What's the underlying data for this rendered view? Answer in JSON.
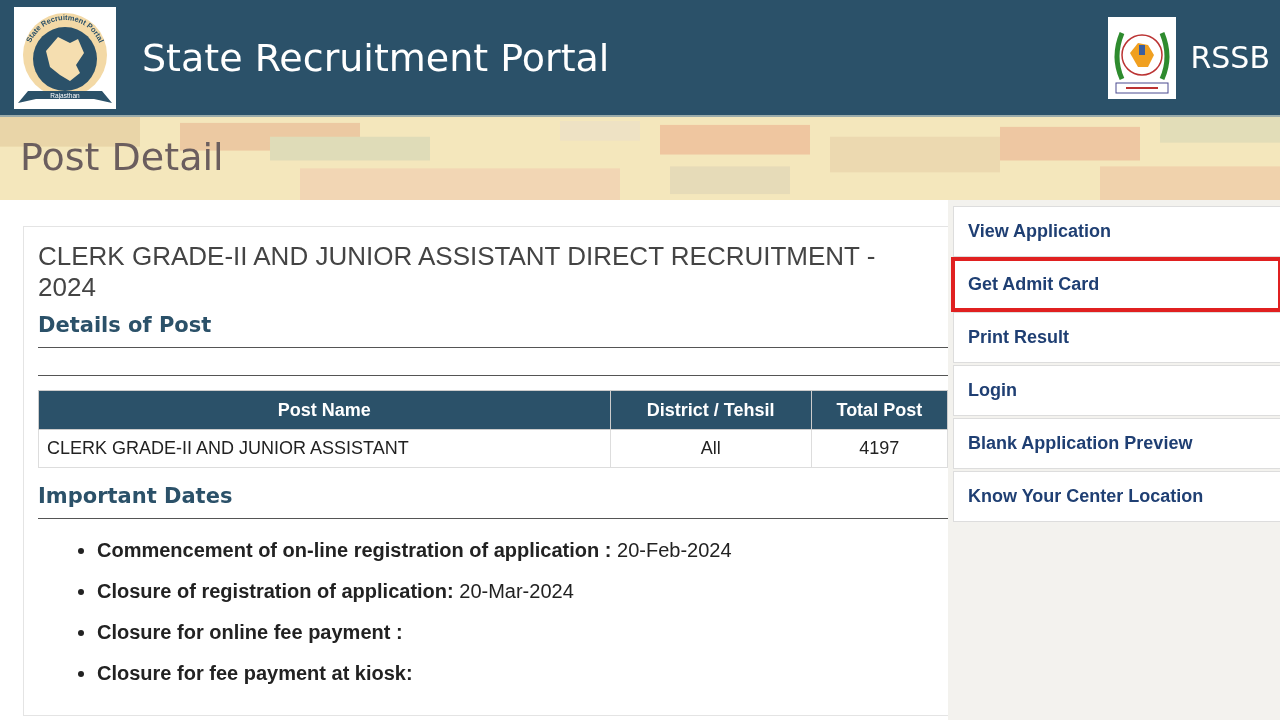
{
  "header": {
    "logo": {
      "arc_text": "State Recruitment Portal",
      "ribbon_text": "Rajasthan"
    },
    "title": "State Recruitment Portal",
    "org": "RSSB"
  },
  "banner": {
    "kind": "picture",
    "title": "Post Detail"
  },
  "post": {
    "title": "CLERK GRADE-II AND JUNIOR ASSISTANT DIRECT RECRUITMENT - 2024",
    "details_heading": "Details of Post",
    "table": {
      "columns": [
        "Post Name",
        "District / Tehsil",
        "Total Post"
      ],
      "rows": [
        [
          "CLERK GRADE-II AND JUNIOR ASSISTANT",
          "All",
          "4197"
        ]
      ]
    },
    "dates_heading": "Important Dates",
    "dates": [
      "**Commencement of on-line registration of application :** 20-Feb-2024",
      "**Closure of registration of application:** 20-Mar-2024",
      "**Closure for online fee payment :**",
      "**Closure for fee payment at kiosk:**"
    ]
  },
  "sidebar": {
    "items": [
      {
        "label": "View Application",
        "highlighted": false
      },
      {
        "label": "Get Admit Card",
        "highlighted": true
      },
      {
        "label": "Print Result",
        "highlighted": false
      },
      {
        "label": "Login",
        "highlighted": false
      },
      {
        "label": "Blank Application Preview",
        "highlighted": false
      },
      {
        "label": "Know Your Center Location",
        "highlighted": false
      }
    ]
  }
}
